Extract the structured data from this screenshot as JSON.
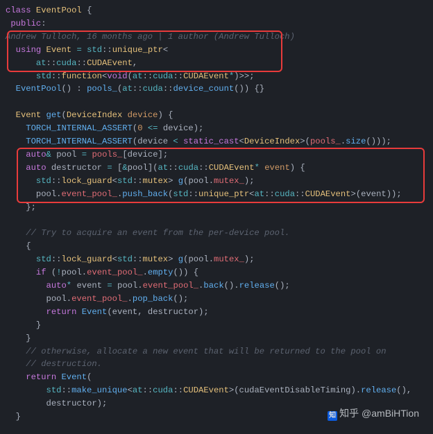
{
  "blame": "Andrew Tulloch, 16 months ago | 1 author (Andrew Tulloch)",
  "watermark": {
    "logo": "知",
    "text": "知乎 @amBiHTion"
  },
  "code": {
    "l01": "class EventPool {",
    "l02": " public:",
    "l03": "  using Event = std::unique_ptr<",
    "l04": "      at::cuda::CUDAEvent,",
    "l05": "      std::function<void(at::cuda::CUDAEvent*)>>;",
    "l06": "  EventPool() : pools_(at::cuda::device_count()) {}",
    "l07": "",
    "l08": "  Event get(DeviceIndex device) {",
    "l09": "    TORCH_INTERNAL_ASSERT(0 <= device);",
    "l10": "    TORCH_INTERNAL_ASSERT(device < static_cast<DeviceIndex>(pools_.size()));",
    "l11": "    auto& pool = pools_[device];",
    "l12": "    auto destructor = [&pool](at::cuda::CUDAEvent* event) {",
    "l13": "      std::lock_guard<std::mutex> g(pool.mutex_);",
    "l14": "      pool.event_pool_.push_back(std::unique_ptr<at::cuda::CUDAEvent>(event));",
    "l15": "    };",
    "l16": "",
    "l17": "    // Try to acquire an event from the per-device pool.",
    "l18": "    {",
    "l19": "      std::lock_guard<std::mutex> g(pool.mutex_);",
    "l20": "      if (!pool.event_pool_.empty()) {",
    "l21": "        auto* event = pool.event_pool_.back().release();",
    "l22": "        pool.event_pool_.pop_back();",
    "l23": "        return Event(event, destructor);",
    "l24": "      }",
    "l25": "    }",
    "l26": "    // otherwise, allocate a new event that will be returned to the pool on",
    "l27": "    // destruction.",
    "l28": "    return Event(",
    "l29": "        std::make_unique<at::cuda::CUDAEvent>(cudaEventDisableTiming).release(),",
    "l30": "        destructor);",
    "l31": "  }"
  }
}
